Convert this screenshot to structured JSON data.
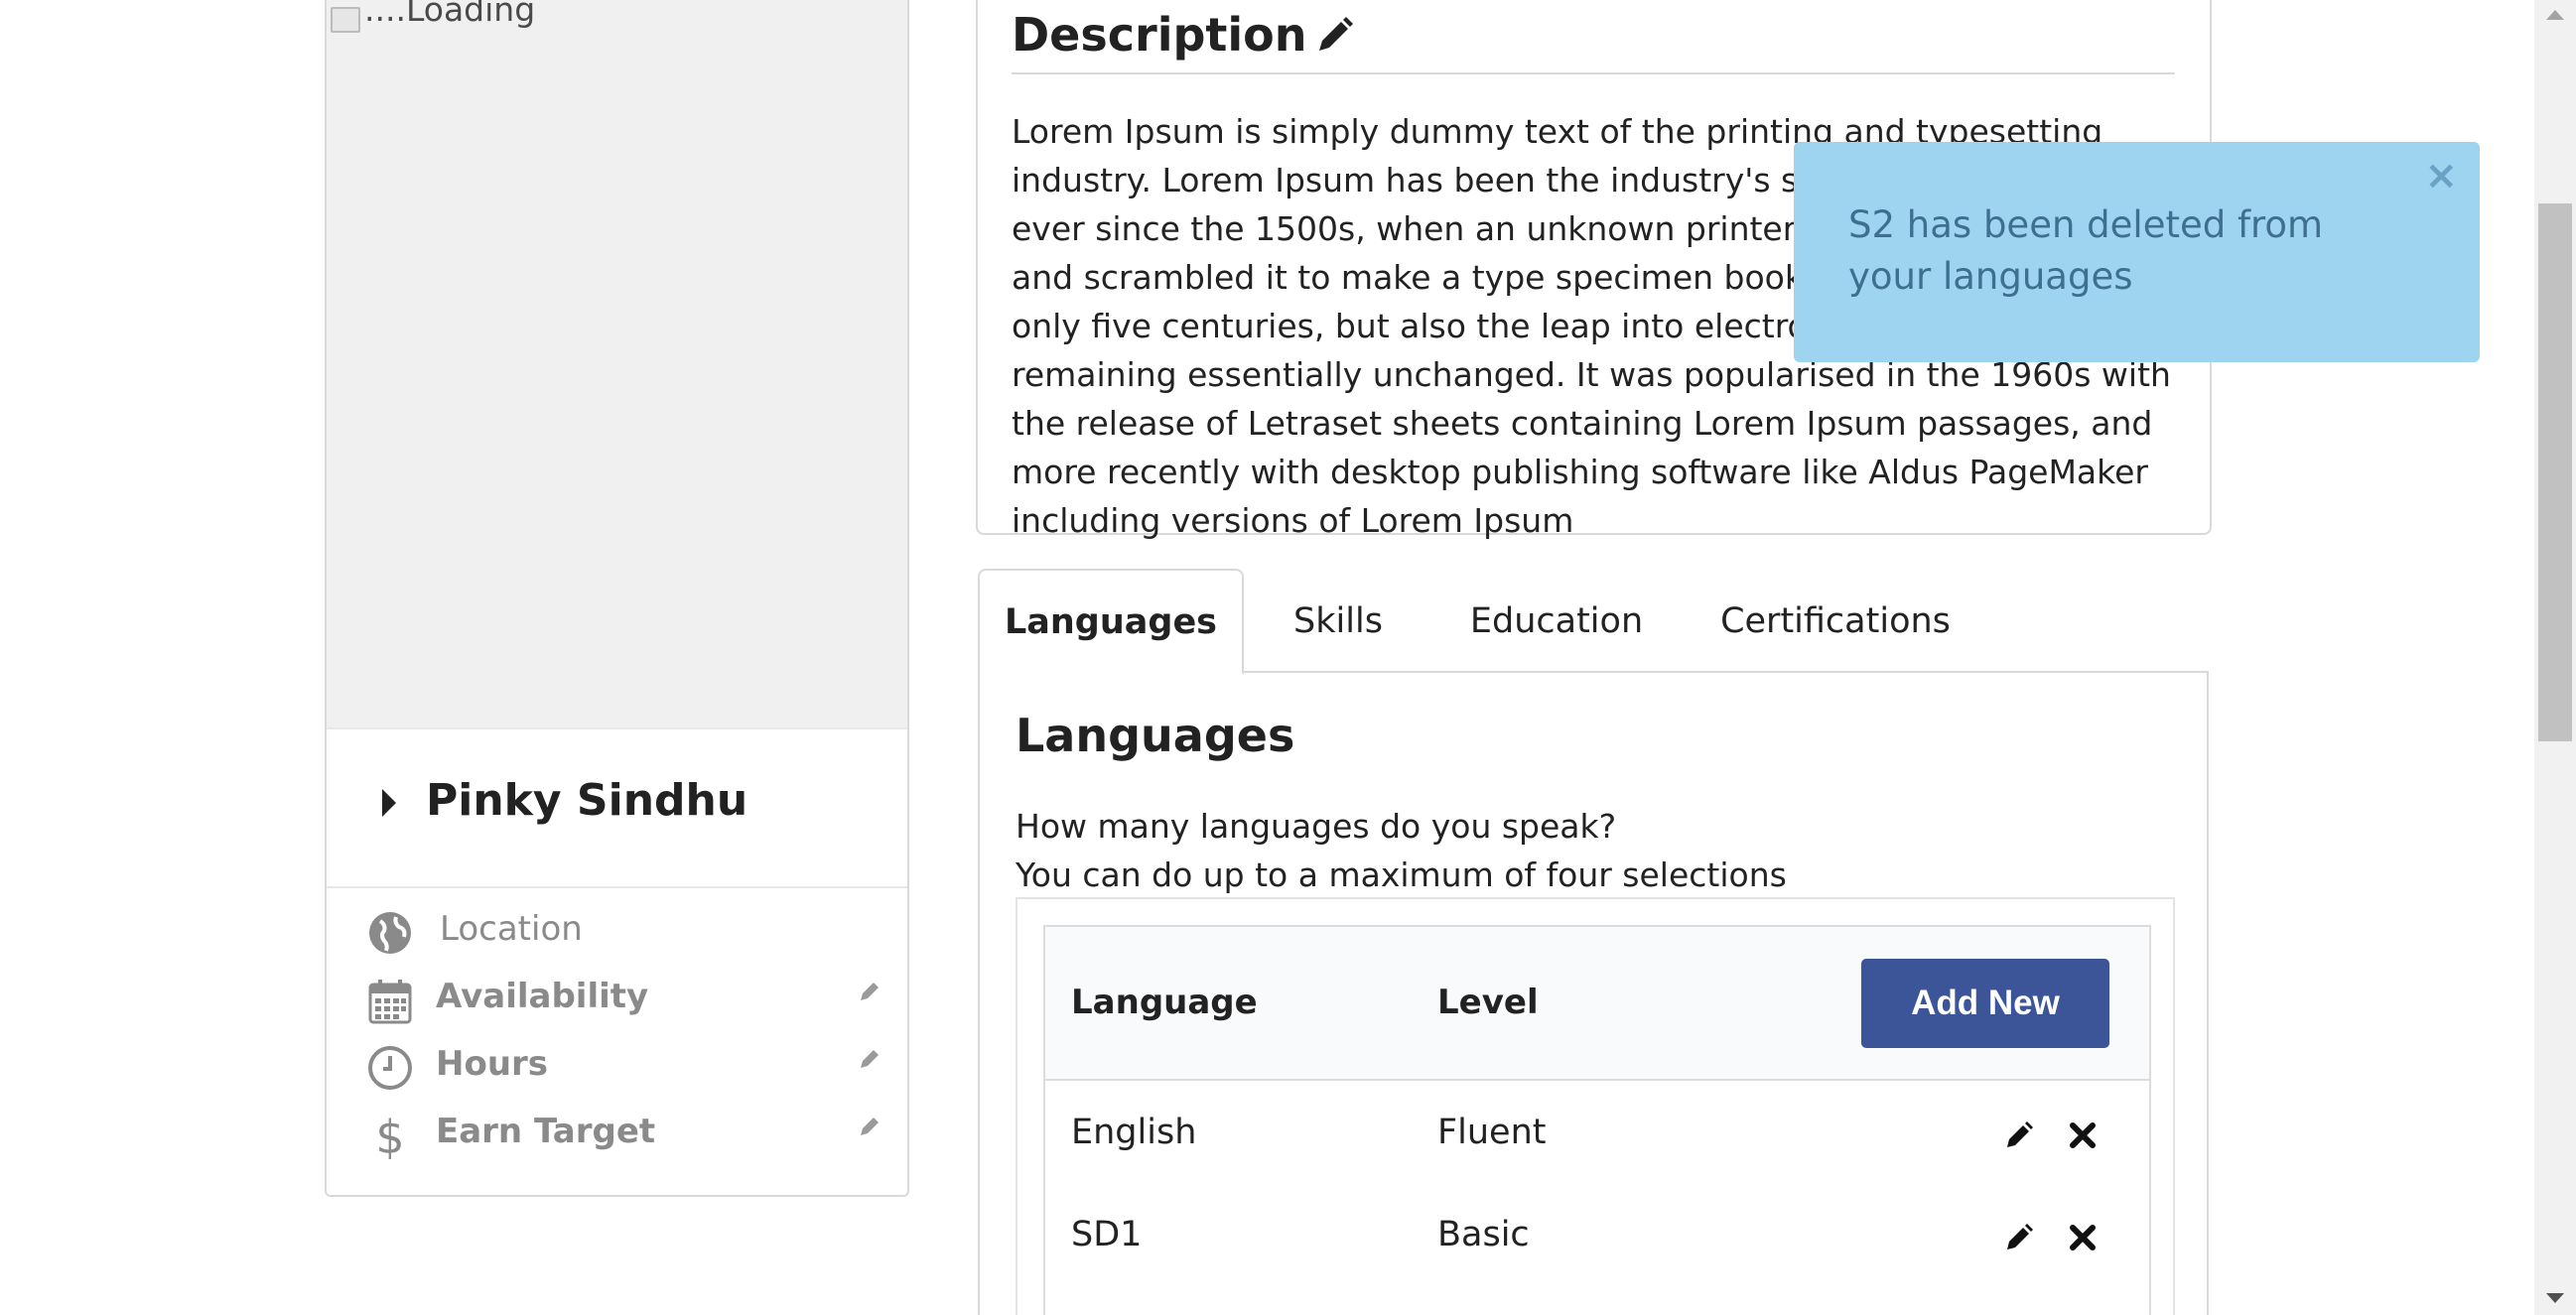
{
  "profile": {
    "photo_alt": "....Loading",
    "name": "Pinky Sindhu",
    "items": [
      {
        "label": "Location",
        "icon": "globe-icon",
        "editable": false
      },
      {
        "label": "Availability",
        "icon": "calendar-icon",
        "editable": true
      },
      {
        "label": "Hours",
        "icon": "clock-icon",
        "editable": true
      },
      {
        "label": "Earn Target",
        "icon": "dollar-icon",
        "editable": true
      }
    ]
  },
  "description": {
    "title": "Description",
    "body": "Lorem Ipsum is simply dummy text of the printing and typesetting industry. Lorem Ipsum has been the industry's standard dummy text ever since the 1500s, when an unknown printer took a galley of type and scrambled it to make a type specimen book. It has survived not only five centuries, but also the leap into electronic typesetting, remaining essentially unchanged. It was popularised in the 1960s with the release of Letraset sheets containing Lorem Ipsum passages, and more recently with desktop publishing software like Aldus PageMaker including versions of Lorem Ipsum"
  },
  "tabs": [
    {
      "label": "Languages",
      "active": true
    },
    {
      "label": "Skills",
      "active": false
    },
    {
      "label": "Education",
      "active": false
    },
    {
      "label": "Certifications",
      "active": false
    }
  ],
  "languages_panel": {
    "title": "Languages",
    "question": "How many languages do you speak?",
    "hint": "You can do up to a maximum of four selections",
    "columns": {
      "language": "Language",
      "level": "Level"
    },
    "add_button": "Add New",
    "rows": [
      {
        "language": "English",
        "level": "Fluent"
      },
      {
        "language": "SD1",
        "level": "Basic"
      }
    ]
  },
  "toast": {
    "message": "S2 has been deleted from your languages",
    "close": "×",
    "color": "#9fd4f0"
  },
  "colors": {
    "primary_button": "#3b5598",
    "muted_text": "#8a8a8a"
  }
}
